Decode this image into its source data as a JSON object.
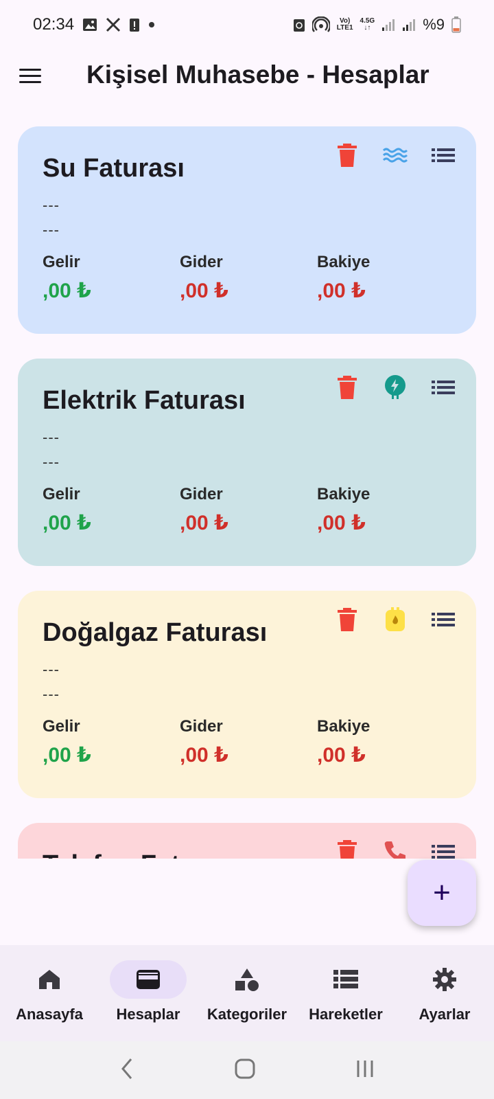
{
  "status_bar": {
    "time": "02:34",
    "battery": "%9",
    "network_top": "Vo)",
    "network_bottom": "LTE1",
    "gen_top": "4.5G"
  },
  "app_bar": {
    "title": "Kişisel Muhasebe - Hesaplar"
  },
  "accounts": [
    {
      "title": "Su Faturası",
      "line1": "---",
      "line2": "---",
      "bg": "#d3e3fd",
      "icon": "water-waves-icon",
      "icon_color": "#4aa3e8",
      "income_label": "Gelir",
      "income": ",00 ₺",
      "expense_label": "Gider",
      "expense": ",00 ₺",
      "balance_label": "Bakiye",
      "balance": ",00 ₺"
    },
    {
      "title": "Elektrik Faturası",
      "line1": "---",
      "line2": "---",
      "bg": "#cce3e7",
      "icon": "electric-bolt-icon",
      "icon_color": "#159a8c",
      "income_label": "Gelir",
      "income": ",00 ₺",
      "expense_label": "Gider",
      "expense": ",00 ₺",
      "balance_label": "Bakiye",
      "balance": ",00 ₺"
    },
    {
      "title": "Doğalgaz Faturası",
      "line1": "---",
      "line2": "---",
      "bg": "#fdf3d9",
      "icon": "gas-flame-icon",
      "icon_color": "#fde047",
      "income_label": "Gelir",
      "income": ",00 ₺",
      "expense_label": "Gider",
      "expense": ",00 ₺",
      "balance_label": "Bakiye",
      "balance": ",00 ₺"
    },
    {
      "title": "Telefon Faturası",
      "bg": "#fdd6da",
      "icon": "phone-icon",
      "icon_color": "#e05252"
    }
  ],
  "colors": {
    "income": "#1fa34a",
    "expense": "#d0302a",
    "delete": "#f04438",
    "fab_bg": "#eaddff",
    "nav_active_pill": "#e8def8"
  },
  "fab": {
    "icon": "plus-icon",
    "label": "+"
  },
  "bottom_nav": {
    "items": [
      {
        "label": "Anasayfa",
        "icon": "home-icon",
        "active": false
      },
      {
        "label": "Hesaplar",
        "icon": "wallet-icon",
        "active": true
      },
      {
        "label": "Kategoriler",
        "icon": "category-icon",
        "active": false
      },
      {
        "label": "Hareketler",
        "icon": "list-icon",
        "active": false
      },
      {
        "label": "Ayarlar",
        "icon": "gear-icon",
        "active": false
      }
    ]
  }
}
